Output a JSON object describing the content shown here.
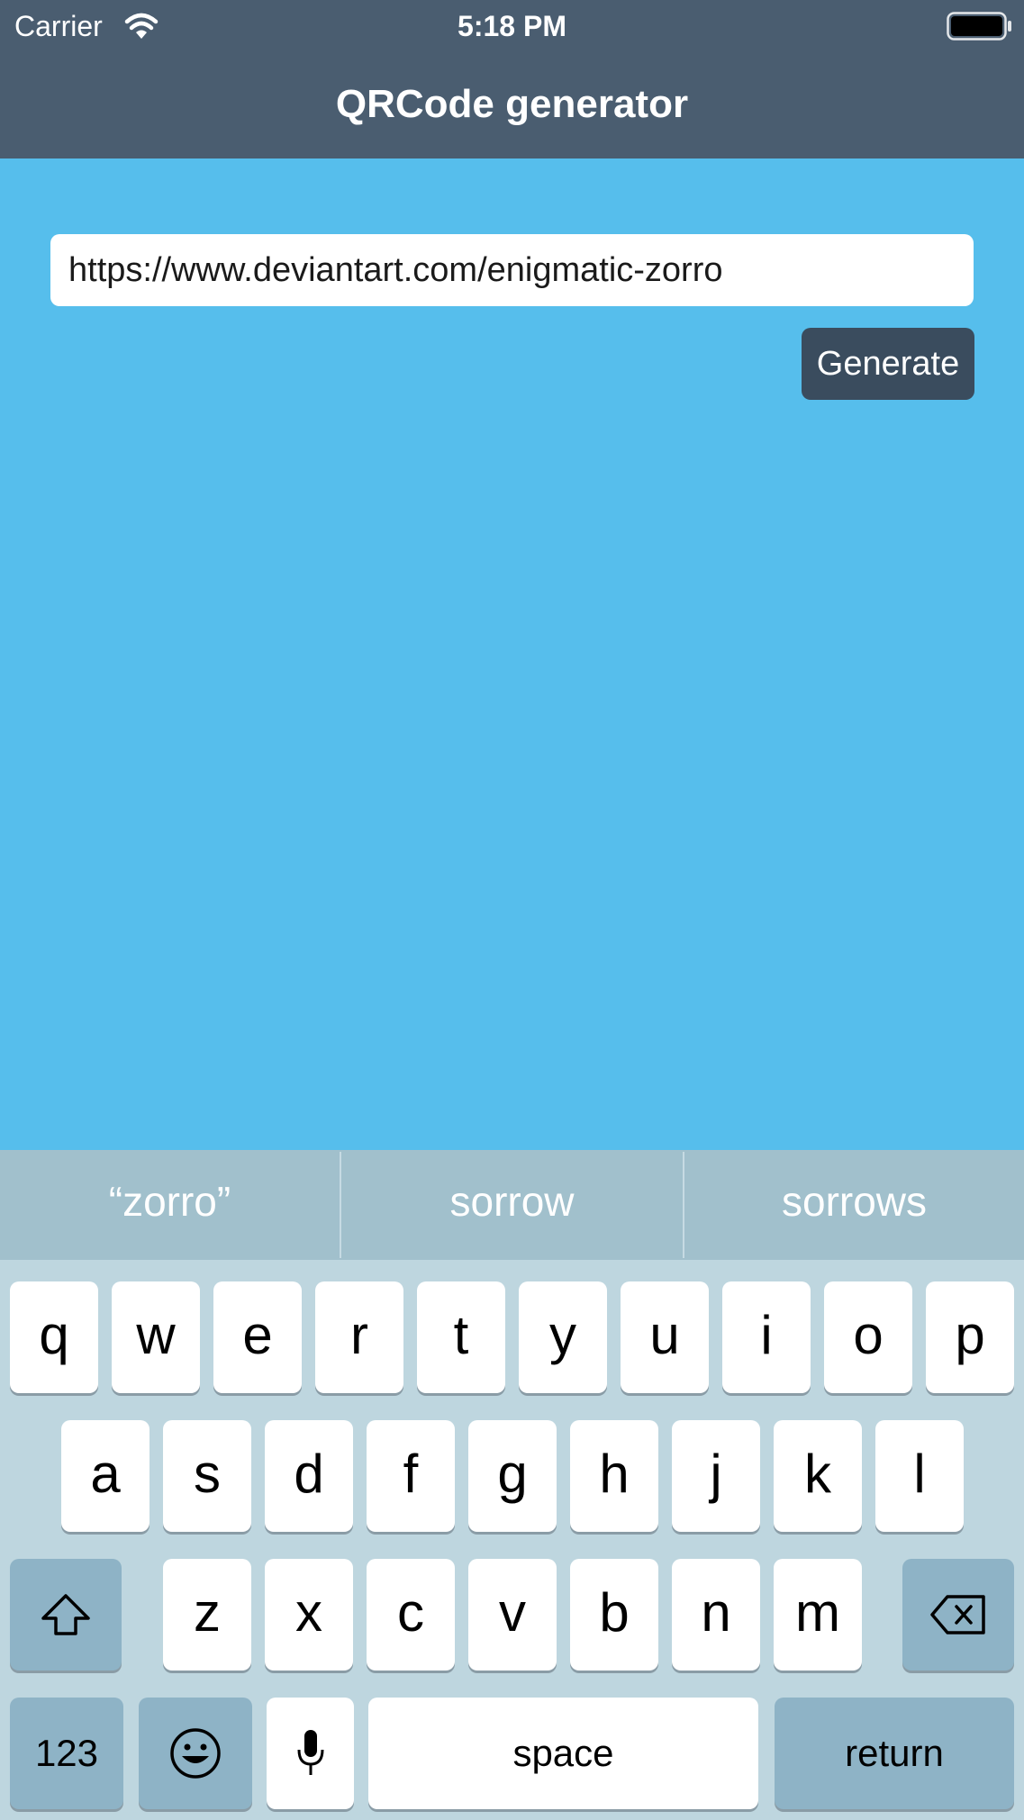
{
  "status_bar": {
    "carrier": "Carrier",
    "time": "5:18 PM",
    "wifi_icon": "wifi-icon",
    "battery_icon": "battery-icon"
  },
  "nav": {
    "title": "QRCode generator"
  },
  "form": {
    "url_value": "https://www.deviantart.com/enigmatic-zorro",
    "generate_label": "Generate"
  },
  "keyboard": {
    "suggestions": [
      "“zorro”",
      "sorrow",
      "sorrows"
    ],
    "row1": [
      "q",
      "w",
      "e",
      "r",
      "t",
      "y",
      "u",
      "i",
      "o",
      "p"
    ],
    "row2": [
      "a",
      "s",
      "d",
      "f",
      "g",
      "h",
      "j",
      "k",
      "l"
    ],
    "row3": [
      "z",
      "x",
      "c",
      "v",
      "b",
      "n",
      "m"
    ],
    "numbers_label": "123",
    "space_label": "space",
    "return_label": "return"
  },
  "colors": {
    "nav_bg": "#4A5D70",
    "content_bg": "#56BEEC",
    "button_bg": "#3A4C5E",
    "keyboard_bg": "#BED6DF",
    "suggestion_bg": "#A1C0CC",
    "func_key": "#8EB3C6"
  }
}
